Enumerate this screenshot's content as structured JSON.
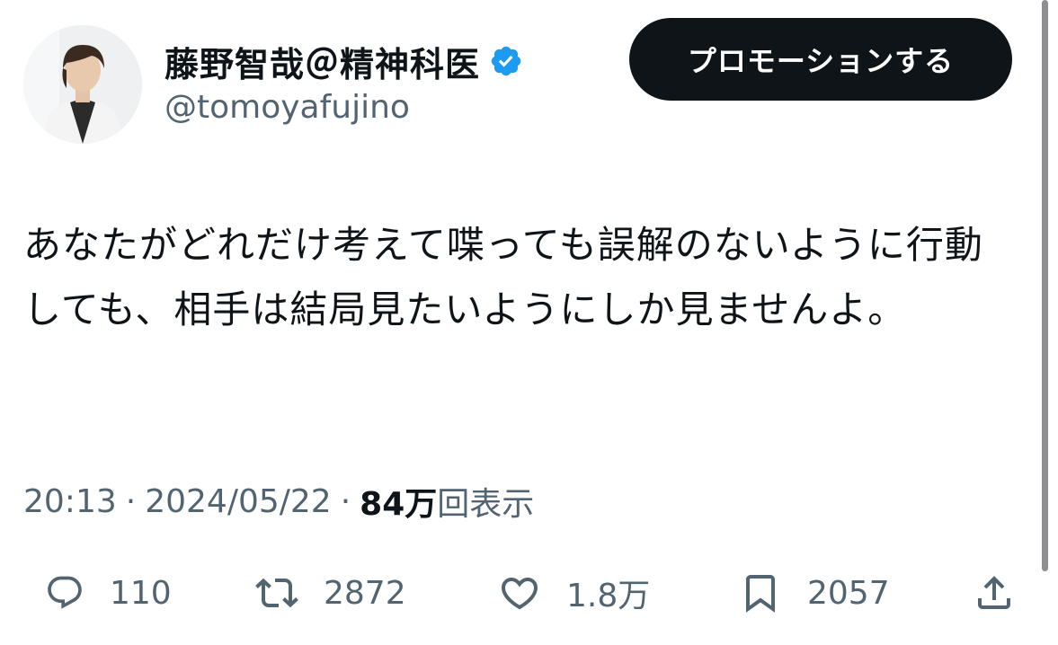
{
  "author": {
    "display_name": "藤野智哉＠精神科医",
    "handle": "@tomoyafujino",
    "verified": true,
    "avatar_icon": "doctor-portrait"
  },
  "header": {
    "promote_label": "プロモーションする"
  },
  "tweet": {
    "text": "あなたがどれだけ考えて喋っても誤解のないように行動しても、相手は結局見たいようにしか見ませんよ。"
  },
  "meta": {
    "time": "20:13",
    "date": "2024/05/22",
    "views_count": "84万",
    "views_label": "回表示",
    "separator": "·"
  },
  "actions": {
    "reply": {
      "icon": "reply-icon",
      "count": "110"
    },
    "retweet": {
      "icon": "retweet-icon",
      "count": "2872"
    },
    "like": {
      "icon": "heart-icon",
      "count": "1.8万"
    },
    "bookmark": {
      "icon": "bookmark-icon",
      "count": "2057"
    },
    "share": {
      "icon": "share-icon"
    }
  },
  "colors": {
    "text_primary": "#0f1419",
    "text_secondary": "#536471",
    "verified_blue": "#1d9bf0",
    "button_bg": "#0f1419"
  }
}
